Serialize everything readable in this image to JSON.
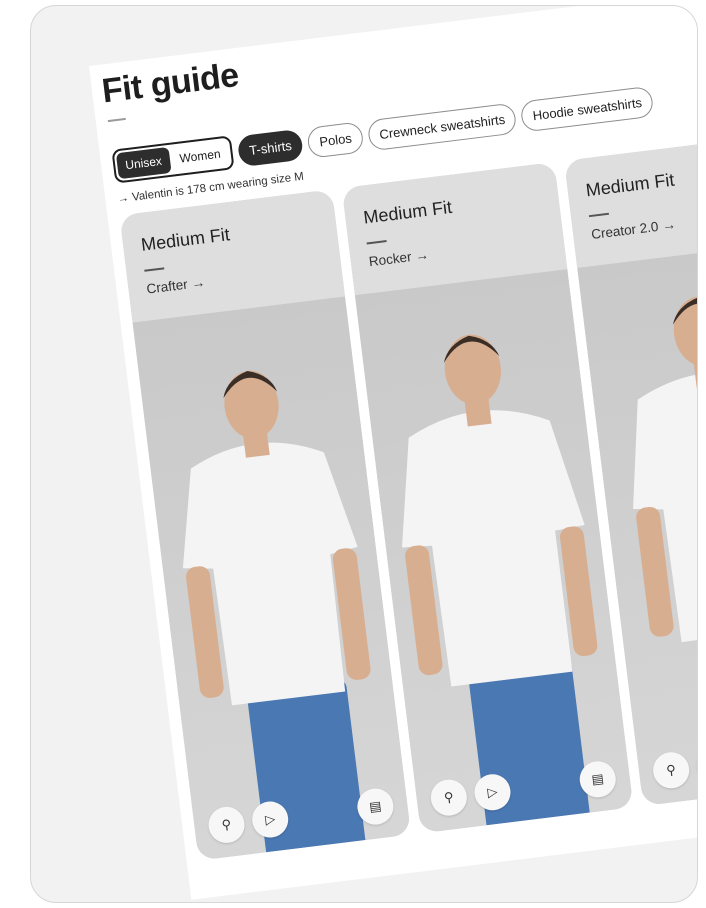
{
  "page": {
    "title": "Fit guide",
    "gender_toggle": [
      {
        "label": "Unisex",
        "active": true
      },
      {
        "label": "Women",
        "active": false
      }
    ],
    "categories": [
      {
        "label": "T-shirts",
        "active": true
      },
      {
        "label": "Polos",
        "active": false
      },
      {
        "label": "Crewneck sweatshirts",
        "active": false
      },
      {
        "label": "Hoodie sweatshirts",
        "active": false
      }
    ],
    "caption_arrow": "→",
    "caption": "Valentin is 178 cm wearing size M"
  },
  "cards": [
    {
      "fit": "Medium Fit",
      "product": "Crafter",
      "arrow": "→"
    },
    {
      "fit": "Medium Fit",
      "product": "Rocker",
      "arrow": "→"
    },
    {
      "fit": "Medium Fit",
      "product": "Creator 2.0",
      "arrow": "→"
    }
  ],
  "icons": {
    "zoom": "zoom-icon",
    "play": "play-icon",
    "document": "document-icon"
  },
  "colors": {
    "active_chip": "#2d2d2d",
    "card_header": "#dedede",
    "photo_bg": "#cfcfcf",
    "jeans": "#4a78b3",
    "tshirt": "#f4f4f4"
  }
}
